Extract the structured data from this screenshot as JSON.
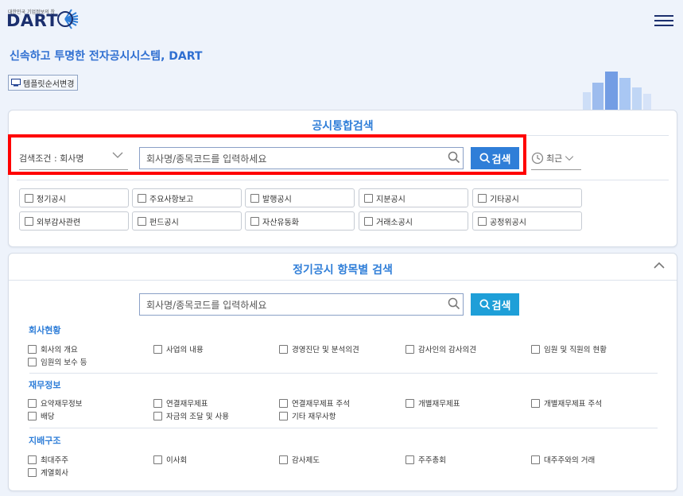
{
  "header": {
    "logo_small": "대한민국 기업정보의 창",
    "logo": "DART",
    "tagline": "신속하고 투명한 전자공시시스템, DART",
    "template_button": "템플릿순서변경",
    "menu_icon": "hamburger-icon"
  },
  "search_panel": {
    "title": "공시통합검색",
    "condition": "검색조건 : 회사명",
    "input_placeholder": "회사명/종목코드를 입력하세요",
    "search_button": "검색",
    "recent_label": "최근",
    "categories": [
      "정기공시",
      "주요사항보고",
      "발행공시",
      "지분공시",
      "기타공시",
      "외부감사관련",
      "펀드공시",
      "자산유동화",
      "거래소공시",
      "공정위공시"
    ]
  },
  "periodic_panel": {
    "title": "정기공시 항목별 검색",
    "input_placeholder": "회사명/종목코드를 입력하세요",
    "search_button": "검색",
    "sections": [
      {
        "title": "회사현황",
        "items": [
          "회사의 개요",
          "사업의 내용",
          "경영진단 및 분석의견",
          "감사인의 감사의견",
          "임원 및 직원의 현황",
          "임원의 보수 등"
        ]
      },
      {
        "title": "재무정보",
        "items": [
          "요약재무정보",
          "연결재무제표",
          "연결재무제표 주석",
          "개별재무제표",
          "개별재무제표 주석",
          "배당",
          "자금의 조달 및 사용",
          "기타 재무사항"
        ]
      },
      {
        "title": "지배구조",
        "items": [
          "최대주주",
          "이사회",
          "감사제도",
          "주주총회",
          "대주주와의 거래",
          "계열회사"
        ]
      }
    ]
  },
  "colors": {
    "brand": "#1b2f6e",
    "accent": "#2f7ed8",
    "highlight": "#ff0000"
  }
}
